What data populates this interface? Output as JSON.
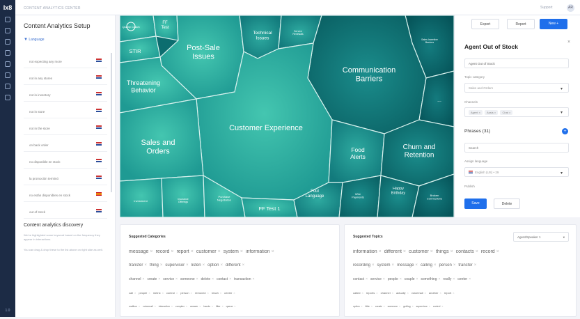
{
  "app": {
    "logo": "Ix8",
    "title": "CONTENT ANALYTICS CENTER",
    "support": "Support",
    "avatar": "AR",
    "version": "1.0"
  },
  "sidebar": {
    "icons": [
      "grid-icon",
      "chat-icon",
      "users-icon",
      "eye-icon",
      "share-icon",
      "list-icon",
      "chart-icon",
      "settings-icon"
    ]
  },
  "setup": {
    "title": "Content Analytics Setup",
    "language_filter": "Language",
    "phrases": [
      {
        "text": "not expecting any more",
        "flag": "us"
      },
      {
        "text": "not in any stores",
        "flag": "us"
      },
      {
        "text": "not in inventory",
        "flag": "us"
      },
      {
        "text": "not in store",
        "flag": "us"
      },
      {
        "text": "not in the store",
        "flag": "us"
      },
      {
        "text": "on back order",
        "flag": "us"
      },
      {
        "text": "no disponible en stock",
        "flag": "us"
      },
      {
        "text": "la promoción terminó",
        "flag": "us"
      },
      {
        "text": "no están disponibles en stock",
        "flag": "es"
      },
      {
        "text": "out of stock",
        "flag": "us"
      }
    ]
  },
  "discovery": {
    "title": "Content analytics discovery",
    "desc1": "We've highlighted some keyword based on the frequency they appear in interactions.",
    "desc2": "You can drag & drop these to the list above on right side as well."
  },
  "treemap": {
    "cells": [
      {
        "label": "Quality Coach"
      },
      {
        "label": "FF Test"
      },
      {
        "label": "STIR"
      },
      {
        "label": "Post-Sale Issues"
      },
      {
        "label": "Technical Issues"
      },
      {
        "label": "Service Renewals"
      },
      {
        "label": "Sales Incentive Barriers"
      },
      {
        "label": "Threatening Behavior"
      },
      {
        "label": "Communication Barriers"
      },
      {
        "label": "Customer Experience"
      },
      {
        "label": "..."
      },
      {
        "label": "Sales and Orders"
      },
      {
        "label": "Food Alerts"
      },
      {
        "label": "Churn and Retention"
      },
      {
        "label": "Investment"
      },
      {
        "label": "Insurance Offerings"
      },
      {
        "label": "Purchase Negotiation"
      },
      {
        "label": "FF Test 1"
      },
      {
        "label": "Foul Language"
      },
      {
        "label": "Wire Payments"
      },
      {
        "label": "Happy Birthday"
      },
      {
        "label": "Broken Connections"
      }
    ]
  },
  "panel": {
    "export": "Export",
    "report": "Report",
    "new": "New +",
    "close": "×",
    "title": "Agent Out of Stock",
    "name_value": "Agent Out of Stock",
    "topic_category_label": "Topic category",
    "topic_category_value": "Sales and Orders",
    "channels_label": "Channels",
    "channels": [
      "Agent",
      "Assis",
      "Chat"
    ],
    "phrases_header": "Phrases (31)",
    "plus": "+",
    "search_placeholder": "Search",
    "assign_language_label": "Assign language",
    "assign_language_value": "English (US) • 29",
    "publish_label": "Publish",
    "save": "Save",
    "delete": "Delete"
  },
  "suggested_categories": {
    "title": "Suggested Categories",
    "rows": [
      [
        "message",
        "record",
        "report",
        "customer",
        "system",
        "information"
      ],
      [
        "transfer",
        "thing",
        "supervisor",
        "listen",
        "option",
        "different"
      ],
      [
        "channel",
        "create",
        "service",
        "someone",
        "delete",
        "contact",
        "transaction"
      ],
      [
        "call",
        "people",
        "metric",
        "control",
        "person",
        "removed",
        "reach",
        "center"
      ],
      [
        "mailbox",
        "voicemail",
        "interaction",
        "complex",
        "answer",
        "hands",
        "filter",
        "queue"
      ]
    ]
  },
  "suggested_topics": {
    "title": "Suggested Topics",
    "selector": "Agent/Speaker 1",
    "rows": [
      [
        "information",
        "different",
        "customer",
        "things",
        "contacts",
        "record"
      ],
      [
        "recording",
        "system",
        "message",
        "calling",
        "person",
        "transfer"
      ],
      [
        "contact",
        "service",
        "people",
        "couple",
        "something",
        "really",
        "center"
      ],
      [
        "called",
        "reports",
        "channel",
        "actually",
        "voicemail",
        "another",
        "report"
      ],
      [
        "option",
        "little",
        "create",
        "someone",
        "getting",
        "supervisor",
        "control"
      ]
    ]
  },
  "colors": {
    "accent": "#1f6feb",
    "rail": "#1c2b45",
    "teal_dark": "#0c6d6f",
    "teal_light": "#3fc2ad"
  }
}
